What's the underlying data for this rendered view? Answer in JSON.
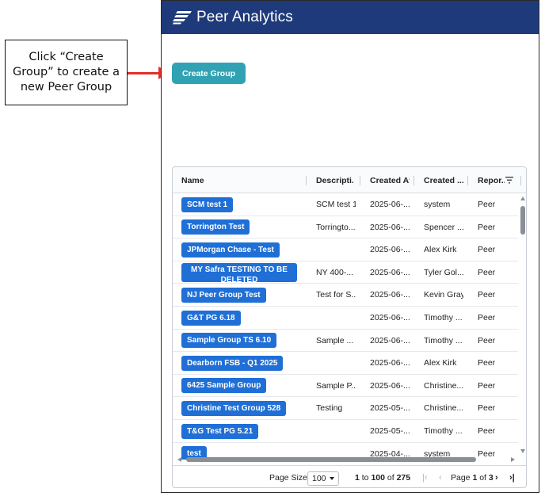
{
  "annotation": {
    "text": "Click “Create\nGroup” to create a\nnew Peer Group"
  },
  "app": {
    "title": "Peer Analytics",
    "logo_icon": "peer-analytics-logo",
    "header_color": "#1f3a7a"
  },
  "actions": {
    "create_group_label": "Create Group",
    "create_group_color": "#31a2b3"
  },
  "grid": {
    "columns": [
      "Name",
      "Descripti...",
      "Created At",
      "Created ...",
      "Repor..."
    ],
    "rows": [
      {
        "name": "SCM test 1",
        "description": "SCM test 1",
        "created_at": "2025-06-...",
        "created_by": "system",
        "report": "Peer"
      },
      {
        "name": "Torrington Test",
        "description": "Torringto...",
        "created_at": "2025-06-...",
        "created_by": "Spencer ...",
        "report": "Peer"
      },
      {
        "name": "JPMorgan Chase - Test",
        "description": "",
        "created_at": "2025-06-...",
        "created_by": "Alex Kirk",
        "report": "Peer"
      },
      {
        "name": "MY Safra TESTING TO BE DELETED",
        "description": "NY 400-...",
        "created_at": "2025-06-...",
        "created_by": "Tyler Gol...",
        "report": "Peer"
      },
      {
        "name": "NJ Peer Group Test",
        "description": "Test for S...",
        "created_at": "2025-06-...",
        "created_by": "Kevin Gray",
        "report": "Peer"
      },
      {
        "name": "G&T PG 6.18",
        "description": "",
        "created_at": "2025-06-...",
        "created_by": "Timothy ...",
        "report": "Peer"
      },
      {
        "name": "Sample Group TS 6.10",
        "description": "Sample ...",
        "created_at": "2025-06-...",
        "created_by": "Timothy ...",
        "report": "Peer"
      },
      {
        "name": "Dearborn FSB - Q1 2025",
        "description": "",
        "created_at": "2025-06-...",
        "created_by": "Alex Kirk",
        "report": "Peer"
      },
      {
        "name": "6425 Sample Group",
        "description": "Sample P...",
        "created_at": "2025-06-...",
        "created_by": "Christine...",
        "report": "Peer"
      },
      {
        "name": "Christine Test Group 528",
        "description": "Testing",
        "created_at": "2025-05-...",
        "created_by": "Christine...",
        "report": "Peer"
      },
      {
        "name": "T&G Test PG 5.21",
        "description": "",
        "created_at": "2025-05-...",
        "created_by": "Timothy ...",
        "report": "Peer"
      },
      {
        "name": "test",
        "description": "",
        "created_at": "2025-04-...",
        "created_by": "system",
        "report": "Peer"
      }
    ]
  },
  "pager": {
    "page_size_label": "Page Size:",
    "page_size_value": "100",
    "range_from": "1",
    "range_to_word": "to",
    "range_to": "100",
    "range_of_word": "of",
    "total": "275",
    "page_word": "Page",
    "current_page": "1",
    "page_of_word": "of",
    "total_pages": "3"
  }
}
